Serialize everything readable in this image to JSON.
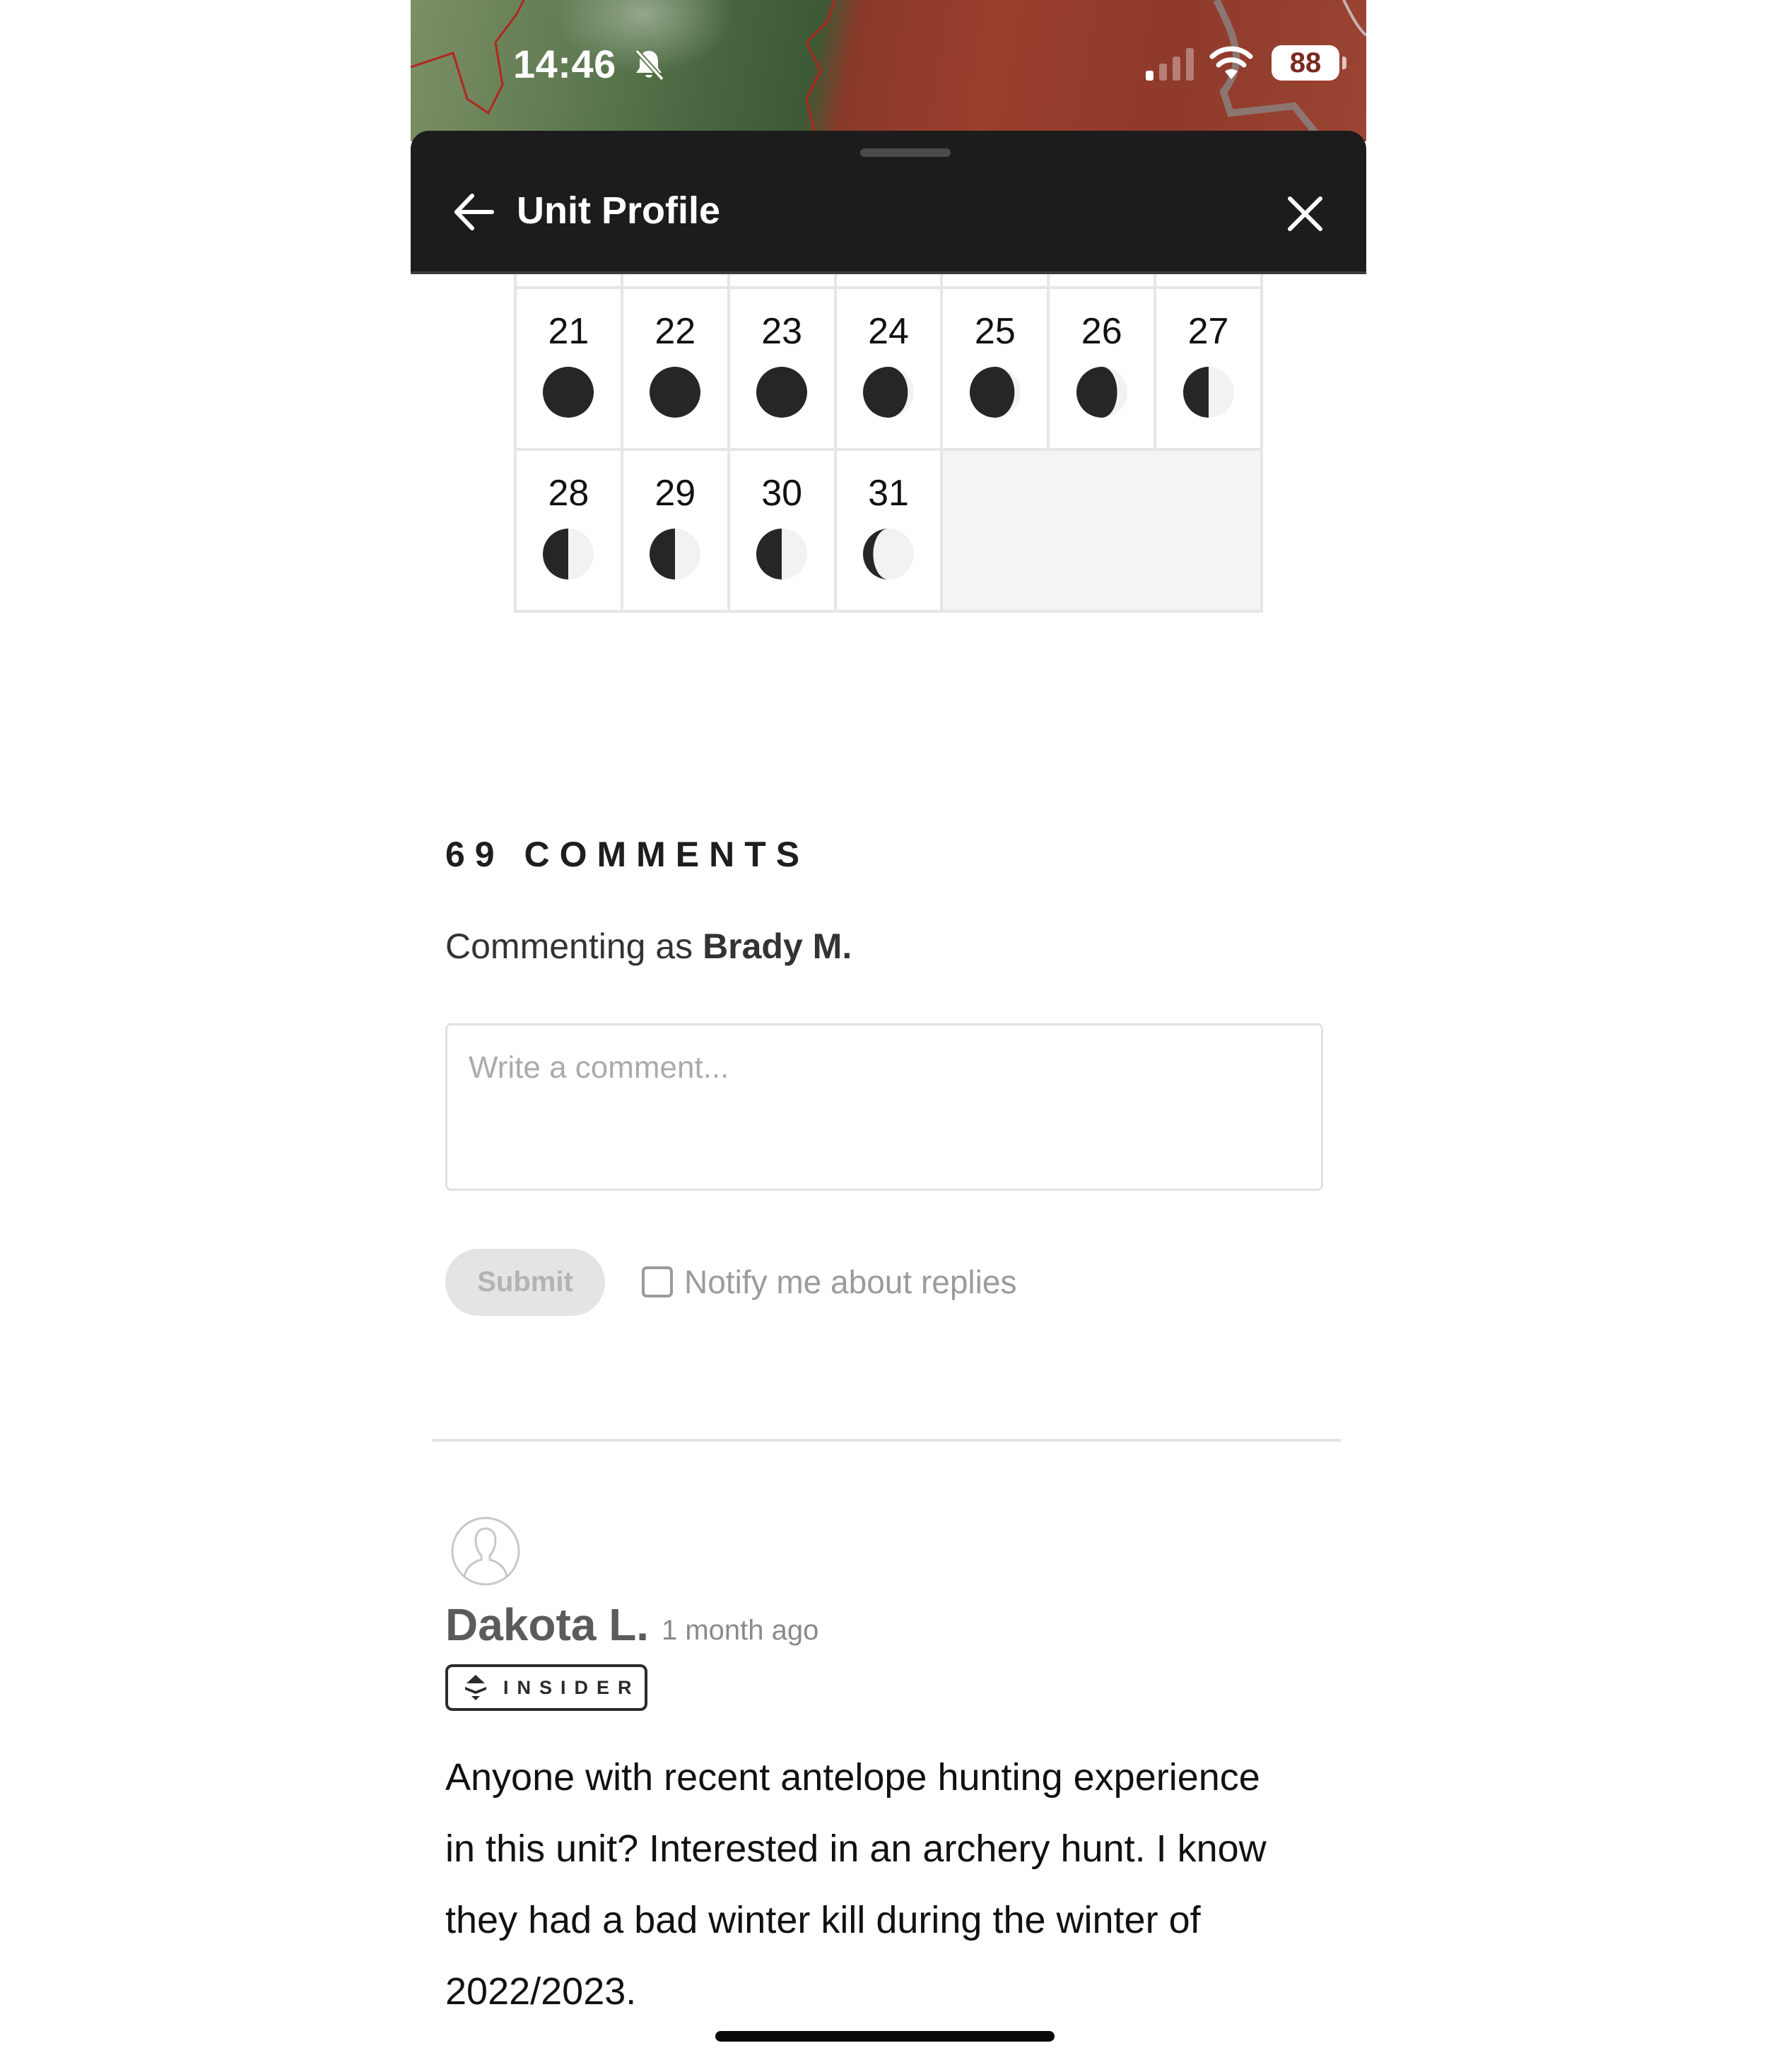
{
  "status_bar": {
    "time": "14:46",
    "silent_mode": true,
    "signal_bars_filled": 1,
    "signal_bars_total": 4,
    "wifi": true,
    "battery_percent": "88"
  },
  "header": {
    "title": "Unit Profile",
    "back_icon": "arrow-left-icon",
    "close_icon": "close-icon"
  },
  "calendar": {
    "rows": [
      [
        {
          "day": "21",
          "phase": "new"
        },
        {
          "day": "22",
          "phase": "new"
        },
        {
          "day": "23",
          "phase": "new"
        },
        {
          "day": "24",
          "phase": "waxing-crescent-thin"
        },
        {
          "day": "25",
          "phase": "waxing-crescent-thin"
        },
        {
          "day": "26",
          "phase": "waxing-crescent"
        },
        {
          "day": "27",
          "phase": "first-quarter"
        }
      ],
      [
        {
          "day": "28",
          "phase": "first-quarter"
        },
        {
          "day": "29",
          "phase": "first-quarter"
        },
        {
          "day": "30",
          "phase": "first-quarter"
        },
        {
          "day": "31",
          "phase": "waxing-gibbous"
        }
      ]
    ],
    "colors": {
      "dark": "#262626",
      "light": "#f2f2f2",
      "grid": "#e6e6e6",
      "empty": "#f4f4f4"
    }
  },
  "comments": {
    "title": "69 COMMENTS",
    "commenting_as_prefix": "Commenting as",
    "commenting_as_user": "Brady M.",
    "input_placeholder": "Write a comment...",
    "input_value": "",
    "submit_label": "Submit",
    "notify_label": "Notify me about replies",
    "notify_checked": false,
    "items": [
      {
        "author": "Dakota L.",
        "timestamp": "1 month ago",
        "badge": "INSIDER",
        "badge_icon": "insider-logo-icon",
        "avatar_icon": "user-avatar-icon",
        "body_lines": [
          "Anyone with recent antelope hunting experience",
          "in this unit? Interested in an archery hunt. I know",
          "they had a bad winter kill during the winter of",
          "2022/2023."
        ]
      }
    ]
  }
}
